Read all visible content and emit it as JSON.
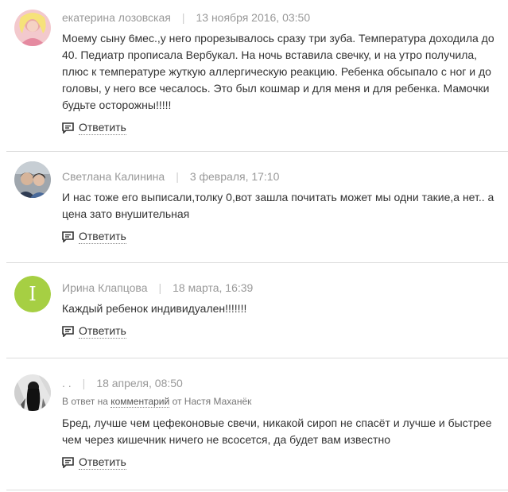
{
  "comments": [
    {
      "author": "екатерина лозовская",
      "date": "13 ноября 2016, 03:50",
      "text": "Моему сыну 6мес.,у него прорезывалось сразу три зуба. Температура доходила до 40. Педиатр прописала Вербукал. На ночь вставила свечку, и на утро получила, плюс к температуре жуткую аллергическую реакцию. Ребенка обсыпало с ног и до головы, у него все чесалось. Это был кошмар и для меня и для ребенка. Мамочки будьте осторожны!!!!!",
      "reply_label": "Ответить",
      "avatar_icon": "user-photo"
    },
    {
      "author": "Светлана Калинина",
      "date": "3 февраля, 17:10",
      "text": "И нас тоже его выписали,толку 0,вот зашла почитать может мы одни такие,а нет.. а цена зато внушительная",
      "reply_label": "Ответить",
      "avatar_icon": "user-photo"
    },
    {
      "author": "Ирина Клапцова",
      "date": "18 марта, 16:39",
      "text": "Каждый ребенок индивидуален!!!!!!!",
      "reply_label": "Ответить",
      "avatar_letter": "I",
      "avatar_color": "#a6cf43"
    },
    {
      "author": ". .",
      "date": "18 апреля, 08:50",
      "reply_prefix": "В ответ на",
      "reply_link": "комментарий",
      "reply_from": "от Настя Маханёк",
      "text": "Бред, лучше чем цефеконовые свечи, никакой сироп не спасёт и лучше и быстрее чем через кишечник ничего не всосется, да будет вам известно",
      "reply_label": "Ответить",
      "avatar_icon": "user-photo"
    }
  ],
  "colors": {
    "meta": "#999999",
    "text": "#333333",
    "divider": "#dcdcdc",
    "letter_avatar": "#a6cf43"
  }
}
